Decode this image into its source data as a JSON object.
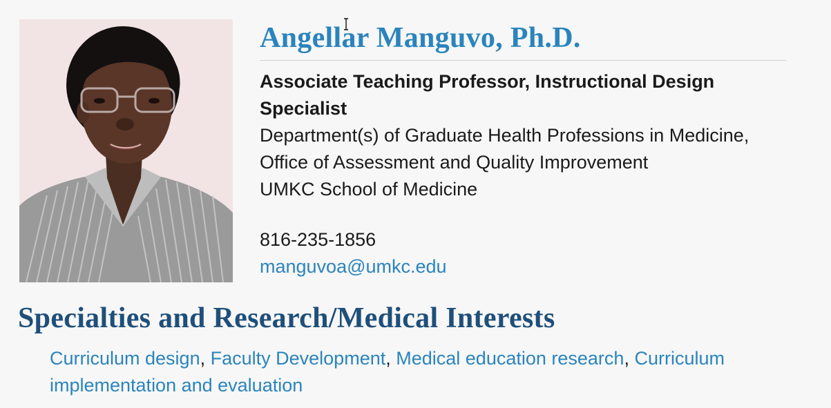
{
  "profile": {
    "name": "Angellar Manguvo, Ph.D.",
    "title": "Associate Teaching Professor, Instructional Design Specialist",
    "department_line1": "Department(s) of Graduate Health Professions in Medicine,",
    "department_line2": "Office of Assessment and Quality Improvement",
    "school": "UMKC School of Medicine",
    "phone": "816-235-1856",
    "email": "manguvoa@umkc.edu"
  },
  "specialties": {
    "heading": "Specialties and Research/Medical Interests",
    "items": [
      "Curriculum design",
      "Faculty Development",
      "Medical education research",
      "Curriculum implementation and evaluation"
    ],
    "separator": ", "
  },
  "colors": {
    "link": "#2a84bd",
    "heading": "#1f4f7a",
    "background": "#f7f7f7",
    "photo_background": "#f2e4e4"
  },
  "icons": {
    "cursor": "text-cursor-icon"
  }
}
